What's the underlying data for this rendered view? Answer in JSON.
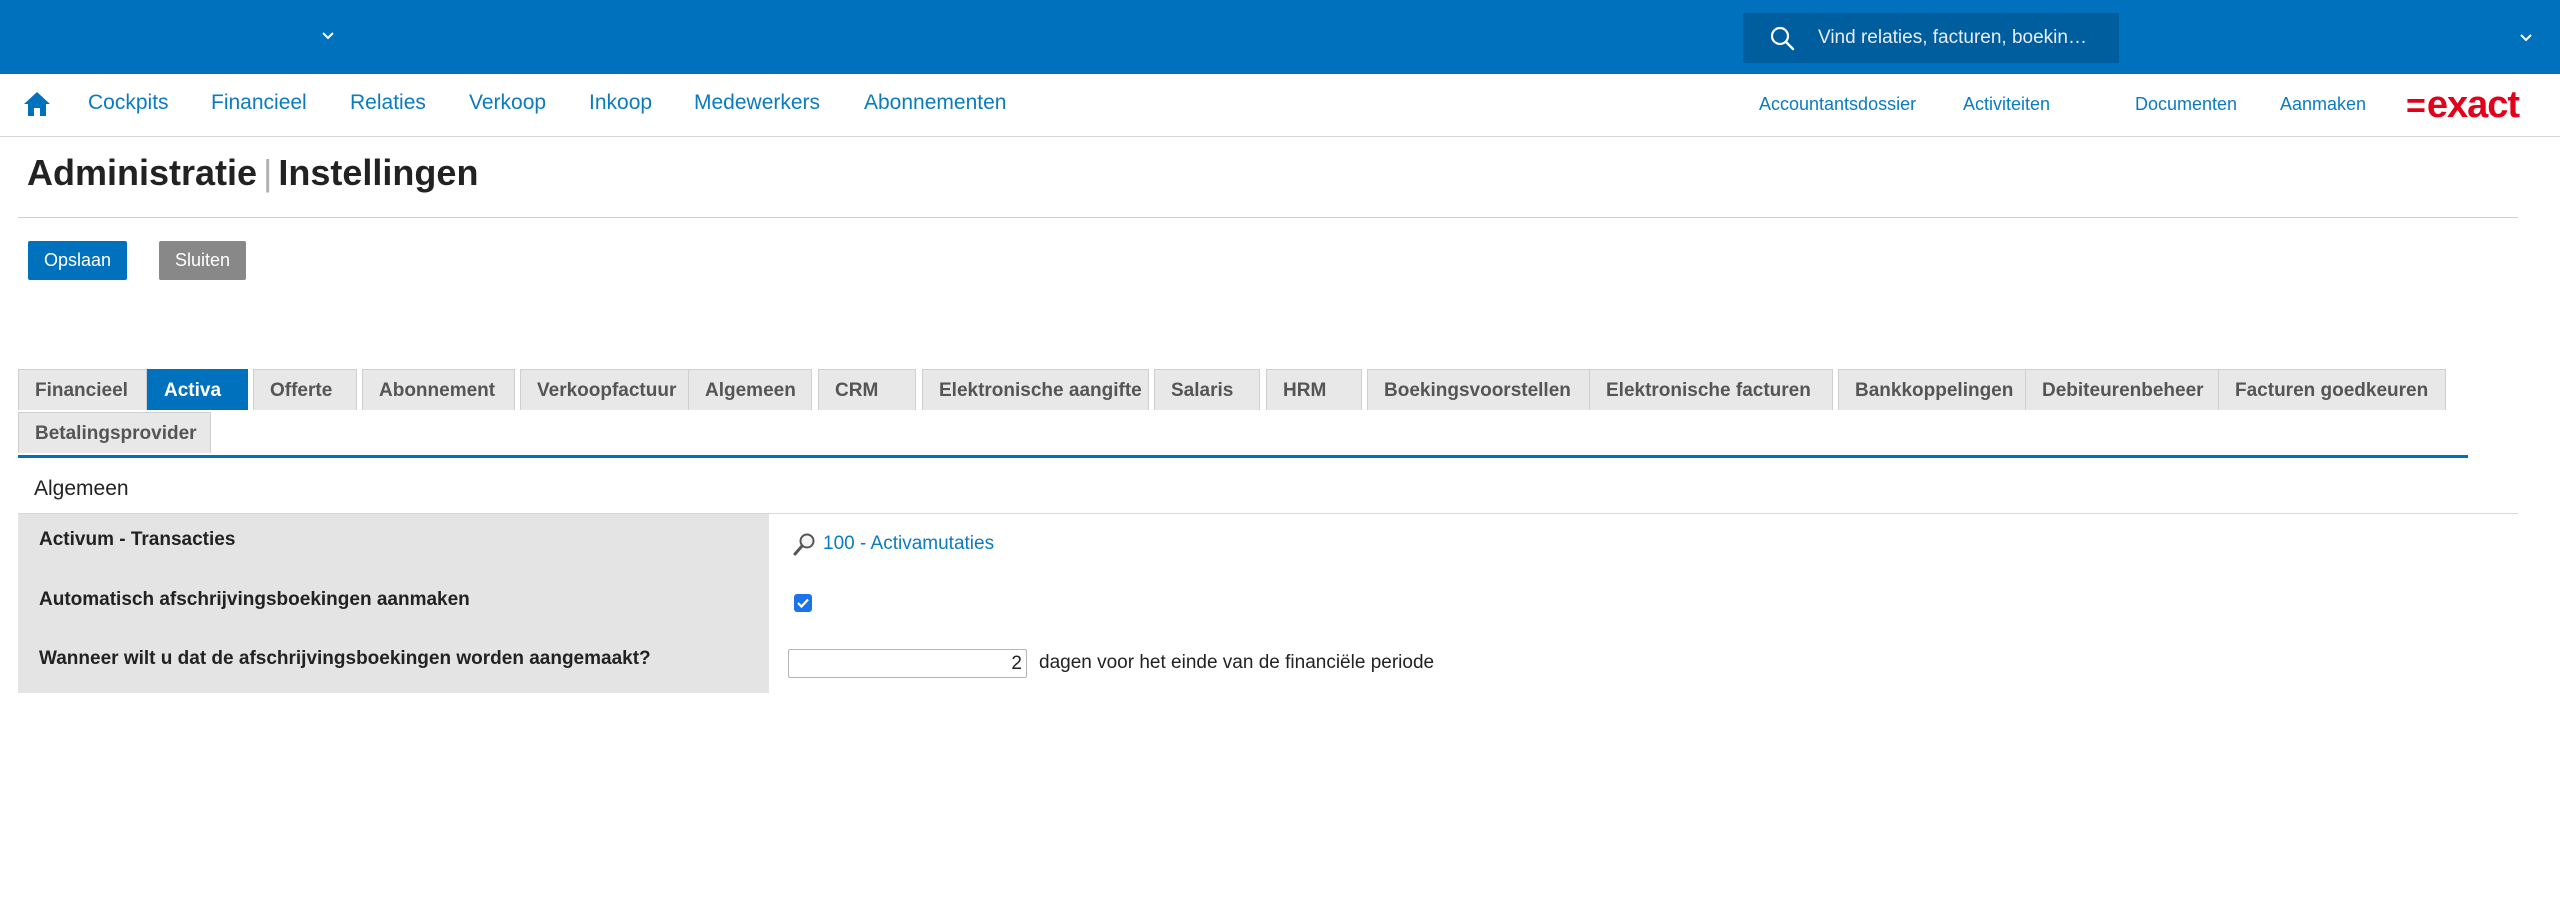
{
  "topbar": {
    "search_placeholder": "Vind relaties, facturen, boekin…",
    "icons": [
      "chevron-down-icon",
      "search-icon",
      "chevron-down-icon"
    ]
  },
  "menu": {
    "home_icon": "home-icon",
    "items": [
      {
        "label": "Cockpits"
      },
      {
        "label": "Financieel"
      },
      {
        "label": "Relaties"
      },
      {
        "label": "Verkoop"
      },
      {
        "label": "Inkoop"
      },
      {
        "label": "Medewerkers"
      },
      {
        "label": "Abonnementen"
      }
    ],
    "right_items": [
      {
        "label": "Accountantsdossier"
      },
      {
        "label": "Activiteiten"
      },
      {
        "label": "Documenten"
      },
      {
        "label": "Aanmaken"
      }
    ],
    "logo": {
      "mark": "=",
      "text": "exact",
      "color": "#e3001b"
    }
  },
  "page": {
    "title_part1": "Administratie",
    "title_separator": "|",
    "title_part2": "Instellingen"
  },
  "actions": {
    "save_label": "Opslaan",
    "close_label": "Sluiten"
  },
  "tabs": [
    {
      "label": "Financieel"
    },
    {
      "label": "Activa",
      "active": true
    },
    {
      "label": "Offerte"
    },
    {
      "label": "Abonnement"
    },
    {
      "label": "Verkoopfactuur"
    },
    {
      "label": "Algemeen"
    },
    {
      "label": "CRM"
    },
    {
      "label": "Elektronische aangifte"
    },
    {
      "label": "Salaris"
    },
    {
      "label": "HRM"
    },
    {
      "label": "Boekingsvoorstellen"
    },
    {
      "label": "Elektronische facturen"
    },
    {
      "label": "Bankkoppelingen"
    },
    {
      "label": "Debiteurenbeheer"
    },
    {
      "label": "Facturen goedkeuren"
    },
    {
      "label": "Betalingsprovider"
    }
  ],
  "section": {
    "title": "Algemeen",
    "fields": {
      "journal_label": "Activum - Transacties",
      "journal_value": "100 - Activamutaties",
      "auto_depr_label": "Automatisch afschrijvingsboekingen aanmaken",
      "auto_depr_checked": true,
      "when_label": "Wanneer wilt u dat de afschrijvingsboekingen worden aangemaakt?",
      "days_value": "2",
      "days_suffix": "dagen voor het einde van de financiële periode"
    }
  },
  "colors": {
    "brand_blue": "#0071bd",
    "link_blue": "#0a7bc1",
    "label_background": "#e4e4e4"
  }
}
